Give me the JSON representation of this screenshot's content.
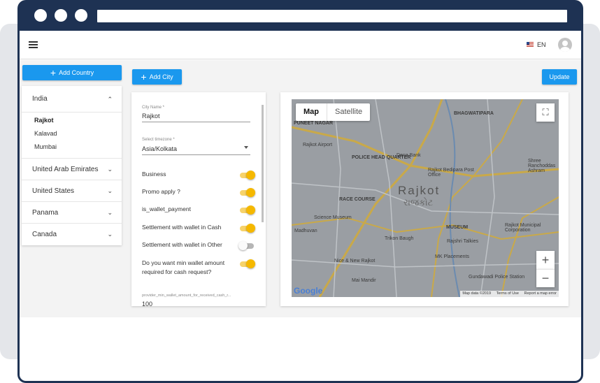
{
  "header": {
    "lang": "EN"
  },
  "sidebar": {
    "add_country_label": "Add Country",
    "countries": [
      {
        "name": "India",
        "expanded": true,
        "cities": [
          "Rajkot",
          "Kalavad",
          "Mumbai"
        ],
        "selected_city": "Rajkot"
      },
      {
        "name": "United Arab Emirates"
      },
      {
        "name": "United States"
      },
      {
        "name": "Panama"
      },
      {
        "name": "Canada"
      }
    ]
  },
  "toolbar": {
    "add_city_label": "Add City",
    "update_label": "Update"
  },
  "form": {
    "city_name_label": "City Name *",
    "city_name_value": "Rajkot",
    "timezone_label": "Select timezone *",
    "timezone_value": "Asia/Kolkata",
    "toggles": [
      {
        "label": "Business",
        "on": true
      },
      {
        "label": "Promo apply ?",
        "on": true
      },
      {
        "label": "is_wallet_payment",
        "on": true
      },
      {
        "label": "Settlement with wallet in Cash",
        "on": true
      },
      {
        "label": "Settlement with wallet in Other",
        "on": false
      },
      {
        "label": "Do you want min wallet amount required for cash request?",
        "on": true
      }
    ],
    "min_amount_label": "provider_min_wallet_amount_for_received_cash_r...",
    "min_amount_value": "100"
  },
  "map": {
    "tab_map": "Map",
    "tab_satellite": "Satellite",
    "city_label": "Rajkot",
    "city_label_local": "રાજકોટ",
    "places": [
      "PUNEET NAGAR",
      "Rajkot Airport",
      "POLICE HEAD QUARTER",
      "Dena Bank",
      "BHAGWATIPARA",
      "Shree Ranchoddas Ashram",
      "RACE COURSE",
      "Rajkot Bedipara Post Office",
      "Science Museum",
      "MUSEUM",
      "Rajkot Municipal Corporation",
      "Trikon Baugh",
      "Rajshri Talkies",
      "Nice & New Rajkot",
      "MK Placements",
      "Gundawadi Police Station",
      "Mai Mandir",
      "Madhuvan"
    ],
    "attribution": "Map data ©2019",
    "terms": "Terms of Use",
    "report": "Report a map error",
    "logo": "Google"
  },
  "colors": {
    "frame": "#1e3253",
    "accent": "#1a98ee",
    "toggle_on": "#f5b800"
  },
  "icons": [
    "hamburger-icon",
    "us-flag-icon",
    "user-avatar-icon",
    "plus-icon",
    "chevron-up-icon",
    "chevron-down-icon",
    "fullscreen-icon",
    "zoom-in-icon",
    "zoom-out-icon",
    "dropdown-caret-icon"
  ]
}
